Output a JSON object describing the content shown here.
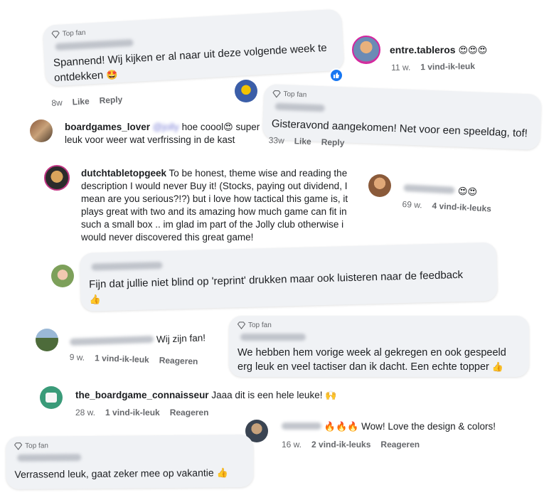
{
  "top_fan_label": "Top fan",
  "comments": {
    "c1": {
      "text": "Spannend! Wij kijken er al naar uit deze volgende week te ontdekken",
      "emoji": "🤩",
      "time": "8w",
      "like": "Like",
      "reply": "Reply"
    },
    "c2": {
      "name": "entre.tableros",
      "emoji": "😍😍😍",
      "time": "11 w.",
      "likes": "1 vind-ik-leuk"
    },
    "c3": {
      "text": "Gisteravond aangekomen! Net voor een speeldag, tof!",
      "time": "33w",
      "like": "Like",
      "reply": "Reply"
    },
    "c4": {
      "name": "boardgames_lover",
      "mention": "@jolly",
      "text1": "hoe coool",
      "emoji": "😍",
      "text2": "super leuk voor weer wat verfrissing in de kast"
    },
    "c5": {
      "name": "dutchtabletopgeek",
      "text": "To be honest, theme wise and reading the description I would never Buy it! (Stocks, paying out dividend, I mean are you serious?!?) but i love how tactical this game is, it plays great with two and its amazing how much game can fit in such a small box .. im glad im part of the Jolly club otherwise i would never discovered this great game!"
    },
    "c6": {
      "emoji": "😍😍",
      "time": "69 w.",
      "likes": "4 vind-ik-leuks"
    },
    "c7": {
      "text": "Fijn dat jullie niet blind op 'reprint' drukken maar ook luisteren naar de feedback",
      "emoji": "👍"
    },
    "c8": {
      "text": "Wij zijn fan!",
      "time": "9 w.",
      "likes": "1 vind-ik-leuk",
      "reply": "Reageren"
    },
    "c9": {
      "text": "We hebben hem vorige week al gekregen en ook gespeeld erg leuk en veel tactiser dan ik dacht. Een echte topper",
      "emoji": "👍"
    },
    "c10": {
      "name": "the_boardgame_connaisseur",
      "text": "Jaaa dit is een hele leuke!",
      "emoji": "🙌",
      "time": "28 w.",
      "likes": "1 vind-ik-leuk",
      "reply": "Reageren"
    },
    "c11": {
      "emoji": "🔥🔥🔥",
      "text": "Wow! Love the design & colors!",
      "time": "16 w.",
      "likes": "2 vind-ik-leuks",
      "reply": "Reageren"
    },
    "c12": {
      "text": "Verrassend leuk, gaat zeker mee op vakantie",
      "emoji": "👍"
    }
  }
}
